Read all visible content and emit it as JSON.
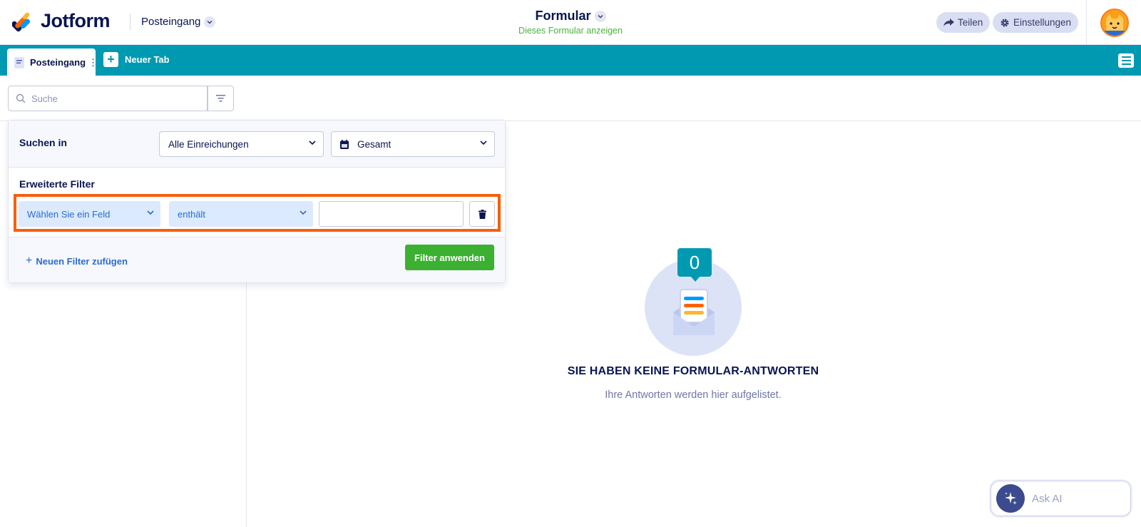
{
  "header": {
    "brand": "Jotform",
    "breadcrumb": "Posteingang",
    "form_title": "Formular",
    "form_subtitle": "Dieses Formular anzeigen",
    "share_label": "Teilen",
    "settings_label": "Einstellungen"
  },
  "tabs": {
    "active_label": "Posteingang",
    "new_tab_label": "Neuer Tab"
  },
  "search": {
    "placeholder": "Suche"
  },
  "filter_panel": {
    "search_in_label": "Suchen in",
    "scope_select_value": "Alle Einreichungen",
    "date_select_value": "Gesamt",
    "advanced_label": "Erweiterte Filter",
    "field_select_value": "Wählen Sie ein Feld",
    "operator_select_value": "enthält",
    "value_input_value": "",
    "add_filter_label": "Neuen Filter zufügen",
    "apply_label": "Filter anwenden"
  },
  "empty_state": {
    "count": "0",
    "title": "SIE HABEN KEINE FORMULAR-ANTWORTEN",
    "subtitle": "Ihre Antworten werden hier aufgelistet."
  },
  "ask_ai": {
    "label": "Ask AI"
  },
  "colors": {
    "brand_teal": "#0099b2",
    "apply_green": "#3bb031",
    "highlight_orange": "#f95e0c",
    "navy": "#0a1551"
  }
}
